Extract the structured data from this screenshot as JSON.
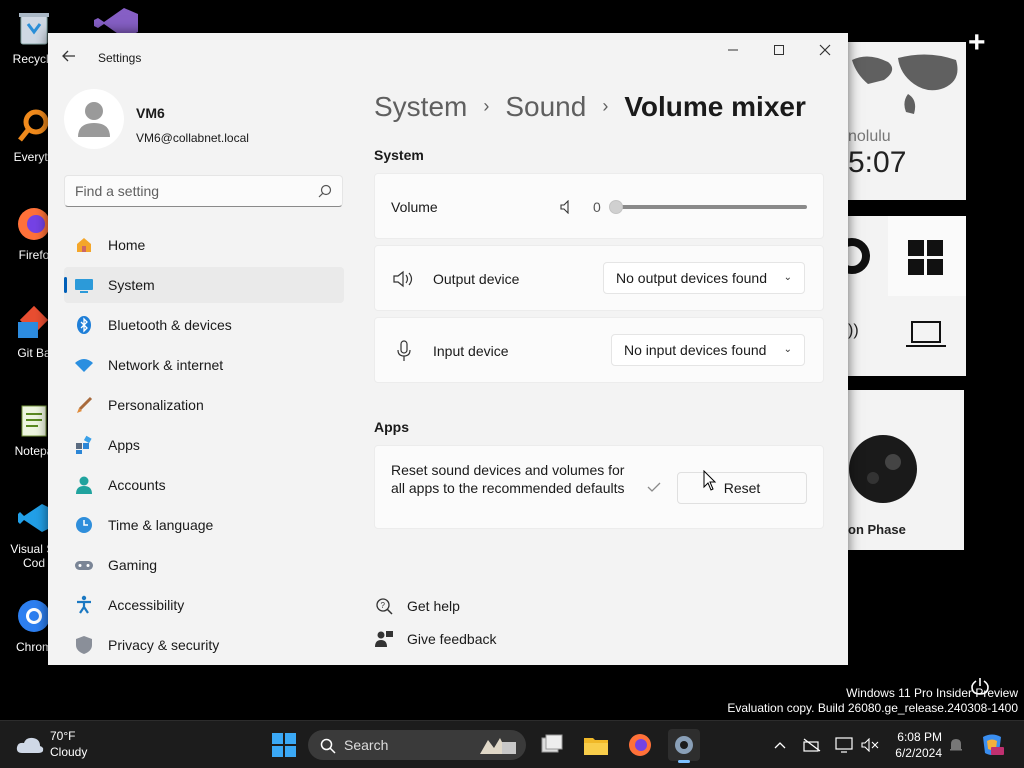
{
  "desktop": {
    "icons": [
      {
        "label": "Recycle"
      },
      {
        "label": "Everyth"
      },
      {
        "label": "Firefo"
      },
      {
        "label": "Git Ba"
      },
      {
        "label": "Notepa"
      },
      {
        "label": "Visual St",
        "label2": "Cod"
      },
      {
        "label": "Chrom"
      }
    ],
    "widgets": {
      "clock_city": "nolulu",
      "clock_time": "5:07",
      "moon_label": "on Phase"
    }
  },
  "window": {
    "title": "Settings",
    "controls": {
      "minimize": "—",
      "maximize": "☐",
      "close": "✕"
    }
  },
  "profile": {
    "name": "VM6",
    "email": "VM6@collabnet.local"
  },
  "search": {
    "placeholder": "Find a setting"
  },
  "nav": {
    "items": [
      {
        "label": "Home",
        "icon": "home-icon"
      },
      {
        "label": "System",
        "icon": "system-icon",
        "active": true
      },
      {
        "label": "Bluetooth & devices",
        "icon": "bluetooth-icon"
      },
      {
        "label": "Network & internet",
        "icon": "network-icon"
      },
      {
        "label": "Personalization",
        "icon": "brush-icon"
      },
      {
        "label": "Apps",
        "icon": "apps-icon"
      },
      {
        "label": "Accounts",
        "icon": "accounts-icon"
      },
      {
        "label": "Time & language",
        "icon": "time-icon"
      },
      {
        "label": "Gaming",
        "icon": "gaming-icon"
      },
      {
        "label": "Accessibility",
        "icon": "accessibility-icon"
      },
      {
        "label": "Privacy & security",
        "icon": "shield-icon"
      }
    ]
  },
  "breadcrumb": {
    "items": [
      "System",
      "Sound",
      "Volume mixer"
    ],
    "separator": "›"
  },
  "system_section": {
    "header": "System",
    "volume_label": "Volume",
    "volume_value": "0",
    "volume_level": 0,
    "output_label": "Output device",
    "output_value": "No output devices found",
    "input_label": "Input device",
    "input_value": "No input devices found"
  },
  "apps_section": {
    "header": "Apps",
    "reset_text": "Reset sound devices and volumes for all apps to the recommended defaults",
    "reset_button": "Reset"
  },
  "links": {
    "get_help": "Get help",
    "give_feedback": "Give feedback"
  },
  "watermark": {
    "line1": "Windows 11 Pro Insider Preview",
    "line2": "Evaluation copy. Build 26080.ge_release.240308-1400"
  },
  "taskbar": {
    "weather_temp": "70°F",
    "weather_desc": "Cloudy",
    "search_label": "Search",
    "time": "6:08 PM",
    "date": "6/2/2024"
  },
  "colors": {
    "accent": "#005fb8",
    "window_bg": "#f3f3f3",
    "card_bg": "#fbfbfb",
    "taskbar_bg": "#1c1c1c"
  }
}
